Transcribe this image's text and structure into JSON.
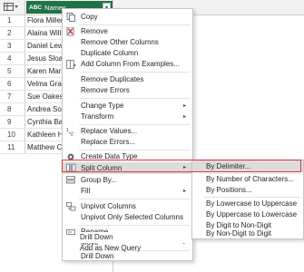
{
  "grid": {
    "column_name": "Names",
    "column_type_icon": "ABC",
    "rows": [
      {
        "n": "1",
        "v": "Flora Miller"
      },
      {
        "n": "2",
        "v": "Alaina William"
      },
      {
        "n": "3",
        "v": "Daniel Lewis"
      },
      {
        "n": "4",
        "v": "Jesus Sloan"
      },
      {
        "n": "5",
        "v": "Karen Martin"
      },
      {
        "n": "6",
        "v": "Velma Gray"
      },
      {
        "n": "7",
        "v": "Sue Oakes"
      },
      {
        "n": "8",
        "v": "Andrea Somm"
      },
      {
        "n": "9",
        "v": "Cynthia Baker"
      },
      {
        "n": "10",
        "v": "Kathleen Hew"
      },
      {
        "n": "11",
        "v": "Matthew Con"
      }
    ]
  },
  "menu": {
    "items": [
      {
        "label": "Copy",
        "icon": "copy-icon",
        "arrow": ""
      },
      {
        "label": "Remove",
        "icon": "remove-x-icon",
        "arrow": ""
      },
      {
        "label": "Remove Other Columns",
        "icon": "",
        "arrow": ""
      },
      {
        "label": "Duplicate Column",
        "icon": "",
        "arrow": ""
      },
      {
        "label": "Add Column From Examples...",
        "icon": "add-column-icon",
        "arrow": ""
      },
      {
        "label": "Remove Duplicates",
        "icon": "",
        "arrow": ""
      },
      {
        "label": "Remove Errors",
        "icon": "",
        "arrow": ""
      },
      {
        "label": "Change Type",
        "icon": "",
        "arrow": "▸"
      },
      {
        "label": "Transform",
        "icon": "",
        "arrow": "▸"
      },
      {
        "label": "Replace Values...",
        "icon": "replace-values-icon",
        "arrow": ""
      },
      {
        "label": "Replace Errors...",
        "icon": "",
        "arrow": ""
      },
      {
        "label": "Create Data Type",
        "icon": "data-type-icon",
        "arrow": ""
      },
      {
        "label": "Split Column",
        "icon": "split-column-icon",
        "arrow": "▸"
      },
      {
        "label": "Group By...",
        "icon": "group-by-icon",
        "arrow": ""
      },
      {
        "label": "Fill",
        "icon": "",
        "arrow": "▸"
      },
      {
        "label": "Unpivot Columns",
        "icon": "unpivot-icon",
        "arrow": ""
      },
      {
        "label": "Unpivot Only Selected Columns",
        "icon": "",
        "arrow": ""
      },
      {
        "label": "Rename...",
        "icon": "rename-icon",
        "arrow": ""
      },
      {
        "label": "Move",
        "icon": "",
        "arrow": "▸"
      },
      {
        "label": "Drill Down",
        "icon": "",
        "arrow": ""
      },
      {
        "label": "Add as New Query",
        "icon": "",
        "arrow": ""
      }
    ]
  },
  "submenu": {
    "items": [
      "By Delimiter...",
      "By Number of Characters...",
      "By Positions...",
      "By Lowercase to Uppercase",
      "By Uppercase to Lowercase",
      "By Digit to Non-Digit",
      "By Non-Digit to Digit"
    ]
  },
  "colors": {
    "column_header": "#217346",
    "highlight": "#dcdcdc",
    "callout_border": "#e0323a"
  }
}
